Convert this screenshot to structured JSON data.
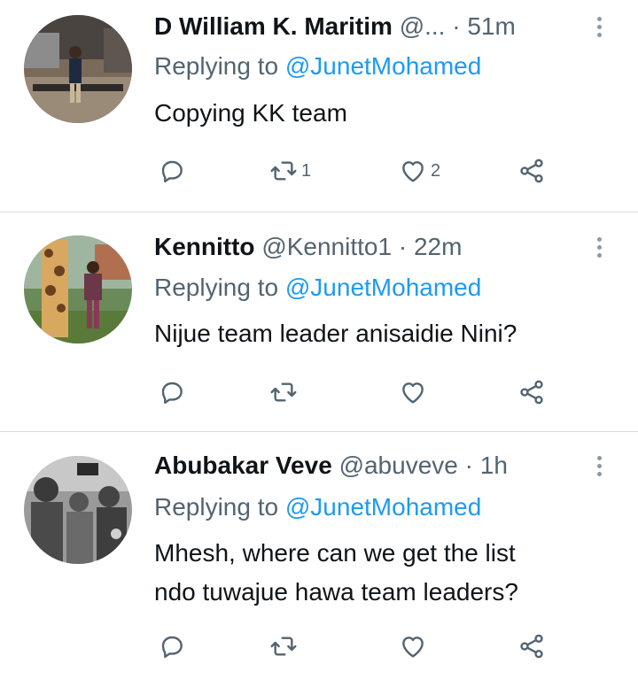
{
  "tweets": [
    {
      "name": "D William K. Maritim",
      "handle": "@...",
      "dot": "·",
      "time": "51m",
      "replying_prefix": "Replying to",
      "replying_handle": "@JunetMohamed",
      "text_lines": [
        "Copying KK team"
      ],
      "retweet_count": "1",
      "like_count": "2"
    },
    {
      "name": "Kennitto",
      "handle": "@Kennitto1",
      "dot": "·",
      "time": "22m",
      "replying_prefix": "Replying to",
      "replying_handle": "@JunetMohamed",
      "text_lines": [
        "Nijue team leader anisaidie Nini?"
      ],
      "retweet_count": "",
      "like_count": ""
    },
    {
      "name": "Abubakar Veve",
      "handle": "@abuveve",
      "dot": "·",
      "time": "1h",
      "replying_prefix": "Replying to",
      "replying_handle": "@JunetMohamed",
      "text_lines": [
        "Mhesh, where can we get the list",
        "ndo tuwajue hawa team leaders?"
      ],
      "retweet_count": "",
      "like_count": ""
    }
  ],
  "icons": {
    "reply": "reply-icon",
    "retweet": "retweet-icon",
    "like": "like-icon",
    "share": "share-icon",
    "more": "more-icon"
  },
  "colors": {
    "accent": "#1d9bf0",
    "secondary_text": "#536471",
    "divider": "#d9dde1"
  }
}
